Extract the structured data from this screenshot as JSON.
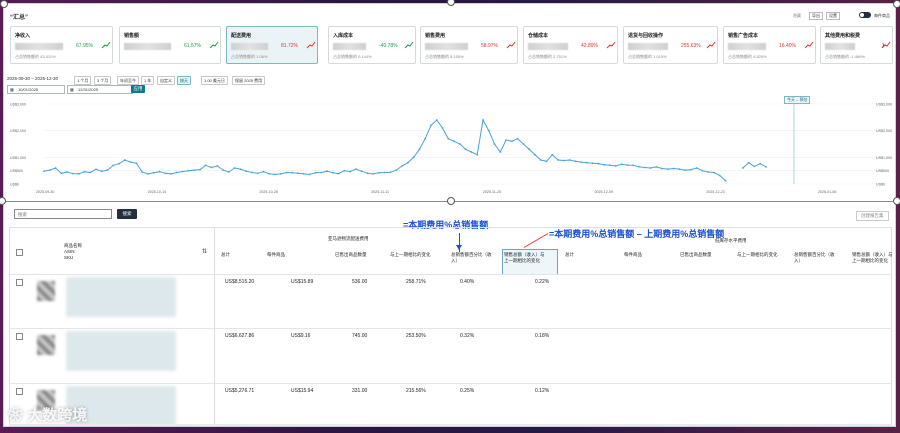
{
  "header": {
    "title": "“汇总”",
    "top_links": [
      "隐藏",
      "设置",
      "每件商品"
    ],
    "top_export": "导出"
  },
  "cards": [
    {
      "title": "净收入",
      "pct": "67.95%",
      "dir": "pos",
      "sub": "占总销售额的 43.411%"
    },
    {
      "title": "销售额",
      "pct": "61.57%",
      "dir": "pos",
      "sub": ""
    },
    {
      "title": "配送费用",
      "pct": "81.72%",
      "dir": "neg",
      "sub": "占总销售额的 1.08%"
    },
    {
      "title": "入库成本",
      "pct": "-40.78%",
      "dir": "pos",
      "sub": "占总销售额的 0.144%"
    },
    {
      "title": "销售费用",
      "pct": "58.97%",
      "dir": "neg",
      "sub": "占总销售额的 8.155%"
    },
    {
      "title": "仓储成本",
      "pct": "42.89%",
      "dir": "neg",
      "sub": "占总销售额的 2.751%"
    },
    {
      "title": "退货与回收操作",
      "pct": "255.63%",
      "dir": "neg",
      "sub": "占总销售额的 1.015%"
    },
    {
      "title": "销售广告成本",
      "pct": "16.40%",
      "dir": "neg",
      "sub": "占总销售额的 4.825%"
    },
    {
      "title": "其他费用和税费",
      "pct": "",
      "dir": "neg",
      "sub": "占总销售额的 -1.466%"
    }
  ],
  "next_icon": "chevron-right-icon",
  "date_range": "2025-09-30 – 2025-12-30",
  "range_chips": [
    "1 个月",
    "3 个月",
    "年初至今",
    "1 年",
    "自定义",
    "按天",
    "1.00 美元日",
    "保留 2025 费用"
  ],
  "active_chip": 5,
  "date_from": "10/01/2025",
  "date_to": "12/31/2025",
  "apply_label": "应用",
  "tooltip": "今天 – 预估",
  "chart_data": {
    "type": "line",
    "y_ticks_left": [
      "US$3,000",
      "US$2,000",
      "US$1,000",
      "US$500",
      "US$0"
    ],
    "y_ticks_right": [
      "US$3,000",
      "US$2,000",
      "US$1,000",
      "US$500",
      "US$0"
    ],
    "x_ticks": [
      "2025-09-30",
      "2025-10-14",
      "2025-10-28",
      "2025-11-11",
      "2025-11-25",
      "2025-12-09",
      "2025-12-23",
      "2026-01-06"
    ],
    "ylim": [
      0,
      3000
    ],
    "series": [
      {
        "values": [
          480,
          520,
          600,
          400,
          450,
          390,
          380,
          460,
          430,
          550,
          480,
          520,
          700,
          760,
          900,
          820,
          780,
          450,
          380,
          420,
          460,
          400,
          380,
          430,
          470,
          500,
          520,
          540,
          700,
          620,
          680,
          520,
          450,
          600,
          560,
          480,
          430,
          400,
          460,
          380,
          360,
          380,
          430,
          420,
          400,
          380,
          360,
          420,
          430,
          480,
          420,
          390,
          500,
          470,
          560,
          480,
          400,
          380,
          420,
          430,
          440,
          520,
          680,
          800,
          1000,
          1300,
          1700,
          2200,
          2400,
          2100,
          1700,
          1600,
          1500,
          1300,
          1200,
          1100,
          2400,
          2000,
          1500,
          1200,
          1650,
          1600,
          1700,
          1500,
          1300,
          1100,
          900,
          850,
          1100,
          900,
          880,
          900,
          850,
          820,
          800,
          780,
          760,
          720,
          700,
          680,
          740,
          710,
          700,
          650,
          620,
          600,
          640,
          580,
          560,
          580,
          560,
          520,
          540,
          600,
          500,
          450,
          430,
          320,
          120,
          null,
          null,
          600,
          800,
          660,
          760,
          640
        ]
      }
    ]
  },
  "search_placeholder": "搜索",
  "search_button": "搜索",
  "create_report": "创建报告集",
  "annotation1": "=本期费用%总销售额",
  "annotation2": "=本期费用%总销售额 – 上期费用%总销售额",
  "table": {
    "product_header": [
      "商品名称",
      "ASIN",
      "SKU"
    ],
    "group1": "亚马逊物流配送费用",
    "group2": "低库存水平费用",
    "cols": [
      "总计",
      "每件商品",
      "已售出商品数量",
      "与上一期相比的变化",
      "总销售额百分比（收入）",
      "销售总额（收入）与上一期相比的变化",
      "总计",
      "每件商品",
      "已售出商品数量",
      "与上一期相比的变化",
      "总销售额百分比（收入）",
      "销售总额（收入）与上一期相比的变化"
    ],
    "rows": [
      [
        "US$8,515.20",
        "US$15.89",
        "536.00",
        "258.71%",
        "0.40%",
        "0.22%"
      ],
      [
        "US$6,627.86",
        "US$9.16",
        "745.00",
        "253.50%",
        "0.32%",
        "0.18%"
      ],
      [
        "US$5,276.71",
        "US$15.94",
        "331.00",
        "215.56%",
        "0.25%",
        "0.12%"
      ]
    ]
  },
  "watermark": "大数跨境"
}
